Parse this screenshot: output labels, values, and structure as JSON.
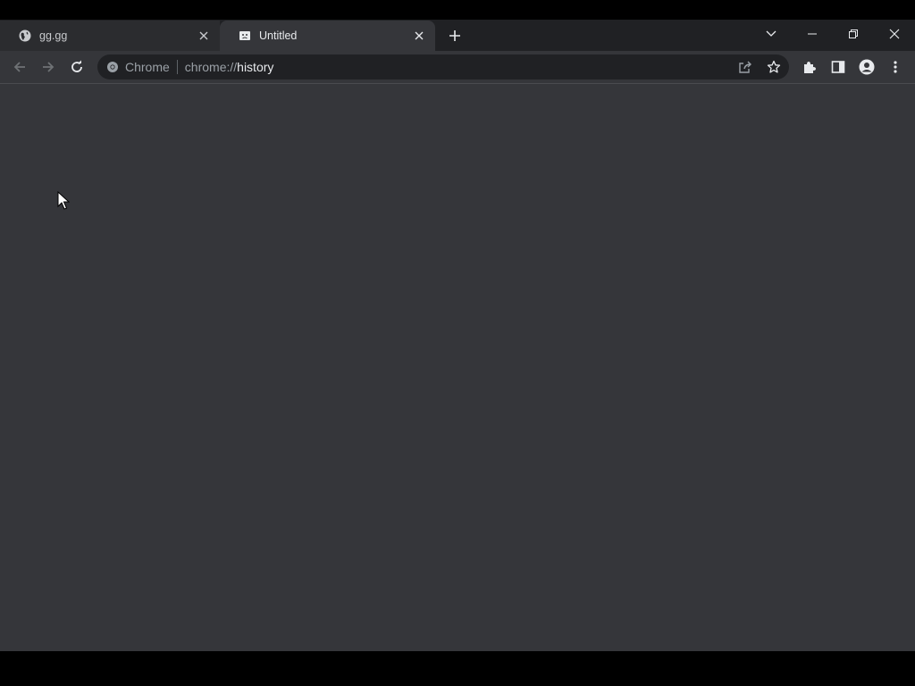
{
  "tabs": [
    {
      "title": "gg.gg",
      "favicon": "globe-icon",
      "active": false
    },
    {
      "title": "Untitled",
      "favicon": "broken-page-icon",
      "active": true
    }
  ],
  "omnibox": {
    "chip_label": "Chrome",
    "url_scheme": "chrome://",
    "url_path": "history"
  },
  "colors": {
    "tabstrip": "#202124",
    "toolbar": "#35363a",
    "omnibox": "#202124",
    "page": "#35363a",
    "text": "#e8eaed",
    "text_dim": "#9aa0a6"
  }
}
